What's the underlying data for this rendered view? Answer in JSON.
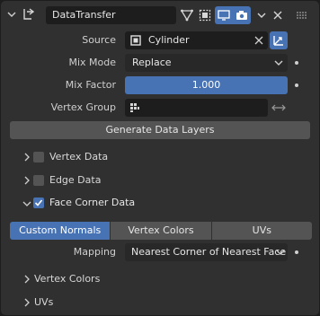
{
  "modifier": {
    "name": "DataTransfer"
  },
  "fields": {
    "source_label": "Source",
    "source_value": "Cylinder",
    "mix_mode_label": "Mix Mode",
    "mix_mode_value": "Replace",
    "mix_factor_label": "Mix Factor",
    "mix_factor_value": "1.000",
    "vertex_group_label": "Vertex Group",
    "vertex_group_value": ""
  },
  "generate_button": "Generate Data Layers",
  "sections": {
    "vertex_data": {
      "label": "Vertex Data",
      "checked": false
    },
    "edge_data": {
      "label": "Edge Data",
      "checked": false
    },
    "face_corner_data": {
      "label": "Face Corner Data",
      "checked": true
    }
  },
  "tabs": [
    {
      "label": "Custom Normals",
      "active": true
    },
    {
      "label": "Vertex Colors",
      "active": false
    },
    {
      "label": "UVs",
      "active": false
    }
  ],
  "mapping": {
    "label": "Mapping",
    "value": "Nearest Corner of Nearest Face"
  },
  "subsections": {
    "vertex_colors": "Vertex Colors",
    "uvs": "UVs"
  },
  "colors": {
    "accent": "#4772b3",
    "panel": "#303030",
    "field": "#1d1d1d",
    "button": "#545454"
  }
}
